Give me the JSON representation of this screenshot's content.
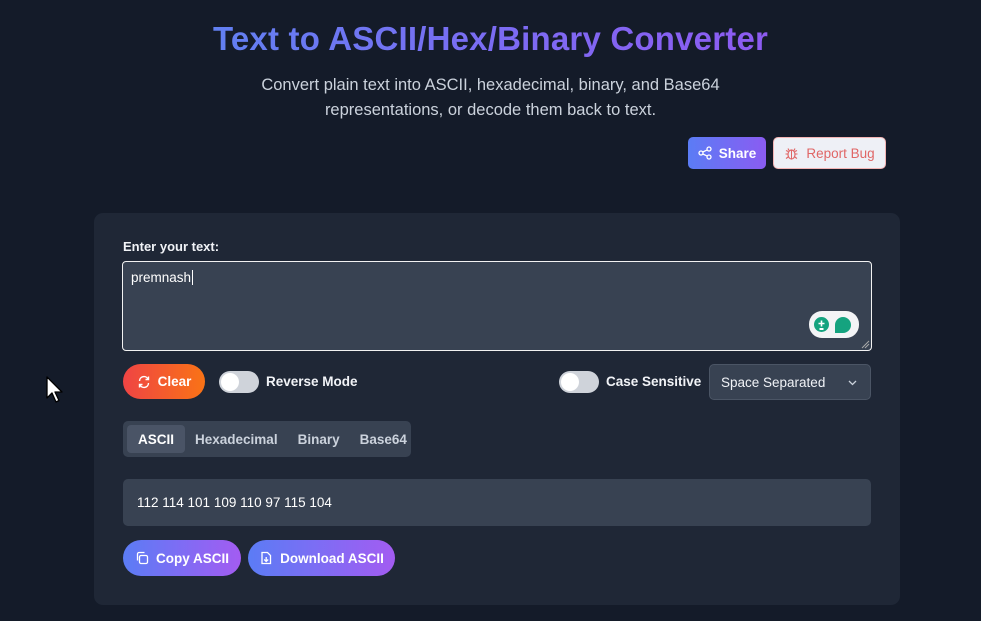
{
  "header": {
    "title": "Text to ASCII/Hex/Binary Converter",
    "subtitle": "Convert plain text into ASCII, hexadecimal, binary, and Base64 representations, or decode them back to text."
  },
  "actions": {
    "share_label": "Share",
    "report_bug_label": "Report Bug"
  },
  "input": {
    "label": "Enter your text:",
    "value": "premnash"
  },
  "controls": {
    "clear_label": "Clear",
    "reverse_mode_label": "Reverse Mode",
    "reverse_mode_on": false,
    "case_sensitive_label": "Case Sensitive",
    "case_sensitive_on": false,
    "separator_selected": "Space Separated"
  },
  "tabs": [
    {
      "label": "ASCII",
      "active": true
    },
    {
      "label": "Hexadecimal",
      "active": false
    },
    {
      "label": "Binary",
      "active": false
    },
    {
      "label": "Base64",
      "active": false
    }
  ],
  "output": {
    "value": "112 114 101 109 110 97 115 104"
  },
  "buttons": {
    "copy_label": "Copy ASCII",
    "download_label": "Download ASCII"
  },
  "colors": {
    "background": "#141b29",
    "card": "#1f2736",
    "accent_start": "#5b7cf5",
    "accent_end": "#a35cf2",
    "clear_start": "#ef4444",
    "clear_end": "#f97316"
  }
}
